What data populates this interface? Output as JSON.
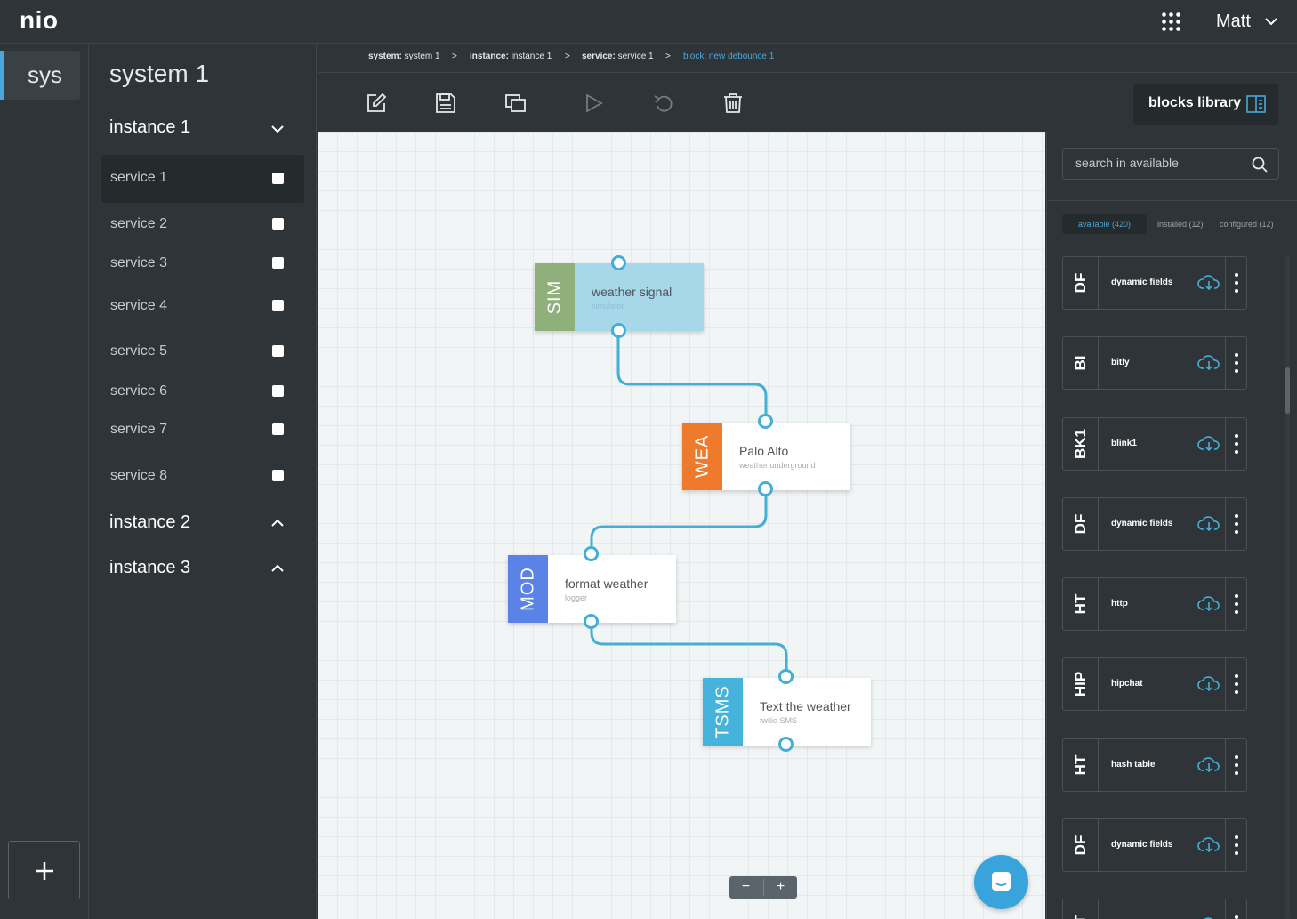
{
  "app": {
    "logo": "nio",
    "user": "Matt"
  },
  "rail": {
    "items": [
      {
        "label": "sys"
      }
    ]
  },
  "tree": {
    "system_title": "system 1",
    "instances": [
      {
        "label": "instance 1",
        "expanded": true
      },
      {
        "label": "instance 2",
        "expanded": false
      },
      {
        "label": "instance 3",
        "expanded": false
      }
    ],
    "services": [
      "service 1",
      "service 2",
      "service 3",
      "service 4",
      "service 5",
      "service 6",
      "service 7",
      "service 8"
    ]
  },
  "breadcrumb": [
    {
      "key": "system:",
      "value": "system 1"
    },
    {
      "key": "instance:",
      "value": "instance 1"
    },
    {
      "key": "service:",
      "value": "service 1"
    },
    {
      "key": "block:",
      "value": "new debounce 1"
    }
  ],
  "breadcrumb_sep": ">",
  "toolbar": {
    "library_label": "blocks library"
  },
  "canvas": {
    "nodes": [
      {
        "code": "SIM",
        "name": "weather signal",
        "type": "simulator",
        "color": "#8fb07a",
        "body_color": "#a6d8ea"
      },
      {
        "code": "WEA",
        "name": "Palo Alto",
        "type": "weather underground",
        "color": "#f07a2c",
        "body_color": "#ffffff"
      },
      {
        "code": "MOD",
        "name": "format weather",
        "type": "logger",
        "color": "#5b82e6",
        "body_color": "#ffffff"
      },
      {
        "code": "TSMS",
        "name": "Text the weather",
        "type": "twilio SMS",
        "color": "#45b3dc",
        "body_color": "#ffffff"
      }
    ],
    "zoom": {
      "minus": "−",
      "plus": "+"
    }
  },
  "library": {
    "search_placeholder": "search in available",
    "filters": [
      {
        "label": "available (420)",
        "active": true
      },
      {
        "label": "installed (12)",
        "active": false
      },
      {
        "label": "configured (12)",
        "active": false
      }
    ],
    "blocks": [
      {
        "code": "DF",
        "name": "dynamic fields"
      },
      {
        "code": "BI",
        "name": "bitly"
      },
      {
        "code": "BK1",
        "name": "blink1"
      },
      {
        "code": "DF",
        "name": "dynamic fields"
      },
      {
        "code": "HT",
        "name": "http"
      },
      {
        "code": "HIP",
        "name": "hipchat"
      },
      {
        "code": "HT",
        "name": "hash table"
      },
      {
        "code": "DF",
        "name": "dynamic fields"
      },
      {
        "code": "HT",
        "name": ""
      }
    ]
  },
  "colors": {
    "accent": "#4aa8d8",
    "wire": "#45aed6",
    "panel": "#2e3438",
    "canvas": "#f2f5f6"
  }
}
